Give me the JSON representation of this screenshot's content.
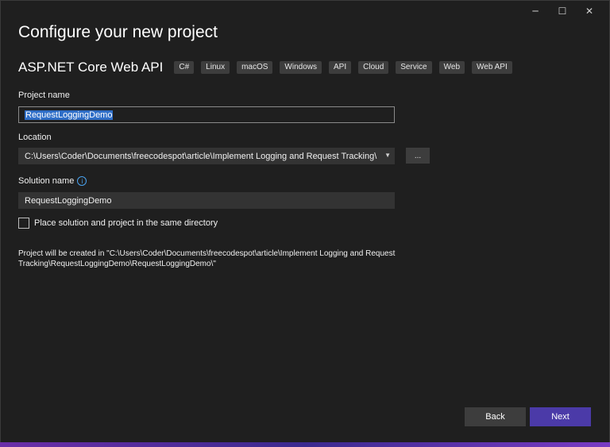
{
  "window": {
    "controls": {
      "minimize": "─",
      "maximize": "☐",
      "close": "✕"
    }
  },
  "title": "Configure your new project",
  "template": {
    "name": "ASP.NET Core Web API",
    "tags": [
      "C#",
      "Linux",
      "macOS",
      "Windows",
      "API",
      "Cloud",
      "Service",
      "Web",
      "Web API"
    ]
  },
  "project_name": {
    "label": "Project name",
    "value": "RequestLoggingDemo"
  },
  "location": {
    "label": "Location",
    "value": "C:\\Users\\Coder\\Documents\\freecodespot\\article\\Implement Logging and Request Tracking\\",
    "browse_label": "..."
  },
  "solution_name": {
    "label": "Solution name",
    "value": "RequestLoggingDemo",
    "info_glyph": "i"
  },
  "same_directory": {
    "label": "Place solution and project in the same directory",
    "checked": false
  },
  "path_info": "Project will be created in \"C:\\Users\\Coder\\Documents\\freecodespot\\article\\Implement Logging and Request Tracking\\RequestLoggingDemo\\RequestLoggingDemo\\\"",
  "buttons": {
    "back": "Back",
    "next": "Next"
  },
  "colors": {
    "accent": "#4b3aa8",
    "selection": "#2f6ec7",
    "info": "#4aa3f0"
  }
}
